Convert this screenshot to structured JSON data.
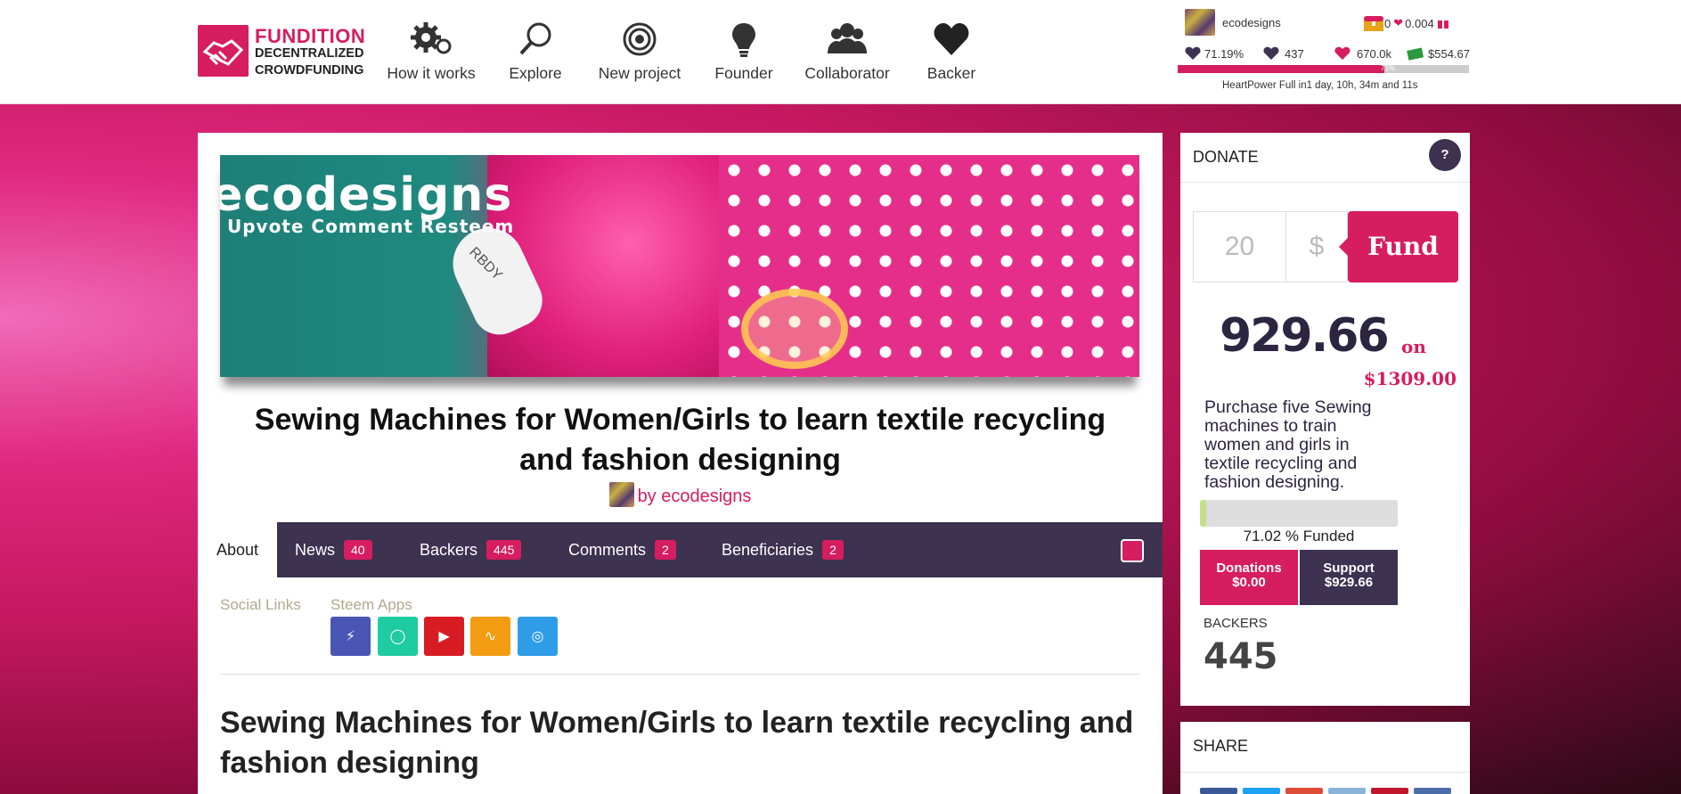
{
  "brand": {
    "title": "FUNDITION",
    "line1": "DECENTRALIZED",
    "line2": "CROWDFUNDING"
  },
  "nav": [
    {
      "label": "How it works",
      "icon": "gears-icon"
    },
    {
      "label": "Explore",
      "icon": "search-icon"
    },
    {
      "label": "New project",
      "icon": "target-icon"
    },
    {
      "label": "Founder",
      "icon": "lightbulb-icon"
    },
    {
      "label": "Collaborator",
      "icon": "group-icon"
    },
    {
      "label": "Backer",
      "icon": "heart-icon"
    }
  ],
  "user": {
    "name": "ecodesigns",
    "chest_count": "0",
    "heart_value": "0.004",
    "voting_power": "71.19%",
    "reputation": "437",
    "power": "670.0k",
    "wallet": "$554.67",
    "hp_percent": 71,
    "hp_percent_label": "71%",
    "heartpower_text": "HeartPower Full in1 day, 10h, 34m and 11s"
  },
  "project": {
    "banner_title": "ecodesigns",
    "banner_sub": "Upvote Comment Resteem",
    "spool_label": "RBDY",
    "title": "Sewing Machines for Women/Girls to learn textile recycling and fashion designing",
    "byline": "by ecodesigns",
    "body_title": "Sewing Machines for Women/Girls to learn textile recycling and fashion designing"
  },
  "tabs": [
    {
      "label": "About",
      "badge": null
    },
    {
      "label": "News",
      "badge": "40"
    },
    {
      "label": "Backers",
      "badge": "445"
    },
    {
      "label": "Comments",
      "badge": "2"
    },
    {
      "label": "Beneficiaries",
      "badge": "2"
    }
  ],
  "about": {
    "social_links_label": "Social Links",
    "steem_apps_label": "Steem Apps",
    "apps": [
      {
        "name": "steempeak",
        "color": "#4a56b4"
      },
      {
        "name": "busy",
        "color": "#1fcba0"
      },
      {
        "name": "dtube",
        "color": "#d71c24"
      },
      {
        "name": "dsound",
        "color": "#f39c12"
      },
      {
        "name": "steemit",
        "color": "#2f9ce8"
      }
    ]
  },
  "donate": {
    "title": "DONATE",
    "help": "?",
    "amount_placeholder": "20",
    "currency": "$",
    "fund_label": "Fund",
    "raised": "929.66",
    "on_label": "on",
    "goal": "$1309.00",
    "description": "Purchase five Sewing machines to train women and girls in textile recycling and fashion designing.",
    "funded_percent": 71.02,
    "funded_label": "71.02 % Funded",
    "donations_label": "Donations",
    "donations_value": "$0.00",
    "support_label": "Support",
    "support_value": "$929.66",
    "backers_label": "BACKERS",
    "backers_count": "445"
  },
  "share": {
    "title": "SHARE"
  },
  "colors": {
    "brand_pink": "#d61d5f",
    "brand_dark": "#3d3250"
  }
}
